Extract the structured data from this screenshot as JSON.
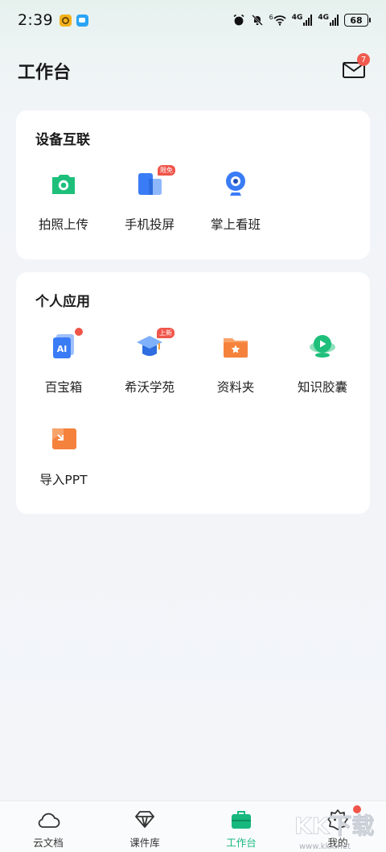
{
  "status_bar": {
    "time": "2:39",
    "network_1": "4G",
    "network_2": "4G",
    "wifi_sup": "6",
    "battery": "68"
  },
  "header": {
    "title": "工作台",
    "mail_badge": "7"
  },
  "device_section": {
    "title": "设备互联",
    "items": [
      {
        "label": "拍照上传",
        "icon": "camera-icon",
        "color": "#1dbf7a"
      },
      {
        "label": "手机投屏",
        "icon": "screen-cast-icon",
        "color": "#3a7cf5",
        "tag": "限免"
      },
      {
        "label": "掌上看班",
        "icon": "webcam-icon",
        "color": "#3a7cf5"
      }
    ]
  },
  "personal_section": {
    "title": "个人应用",
    "items": [
      {
        "label": "百宝箱",
        "icon": "ai-toolbox-icon",
        "color": "#3a7cf5",
        "ai_text": "AI"
      },
      {
        "label": "希沃学苑",
        "icon": "graduation-cap-icon",
        "color": "#3a7cf5",
        "tag": "上新"
      },
      {
        "label": "资料夹",
        "icon": "folder-star-icon",
        "color": "#f5823c"
      },
      {
        "label": "知识胶囊",
        "icon": "play-capsule-icon",
        "color": "#1dbf7a"
      },
      {
        "label": "导入PPT",
        "icon": "import-ppt-icon",
        "color": "#f5823c"
      }
    ]
  },
  "tabbar": {
    "tabs": [
      {
        "label": "云文档",
        "icon": "cloud-icon"
      },
      {
        "label": "课件库",
        "icon": "diamond-icon"
      },
      {
        "label": "工作台",
        "icon": "briefcase-icon",
        "active": true
      },
      {
        "label": "我的",
        "icon": "profile-icon"
      }
    ],
    "accent": "#17b87e"
  },
  "watermark": {
    "text": "KK下载",
    "url": "www.kkx.net"
  }
}
